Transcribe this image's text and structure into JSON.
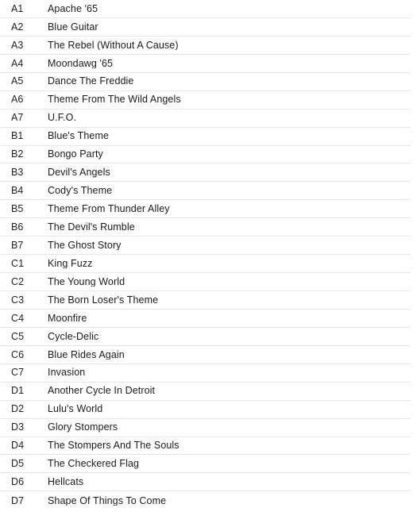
{
  "table": {
    "name": "tracklist",
    "columns": [
      "position",
      "title"
    ],
    "row_count": 28,
    "divider_color": "#e6e6e6",
    "text_color": "#1a1a1a",
    "background_color": "#ffffff"
  },
  "tracks": [
    {
      "position": "A1",
      "title": "Apache '65",
      "duration": ""
    },
    {
      "position": "A2",
      "title": "Blue Guitar",
      "duration": ""
    },
    {
      "position": "A3",
      "title": "The Rebel (Without A Cause)",
      "duration": ""
    },
    {
      "position": "A4",
      "title": "Moondawg '65",
      "duration": ""
    },
    {
      "position": "A5",
      "title": "Dance The Freddie",
      "duration": ""
    },
    {
      "position": "A6",
      "title": "Theme From The Wild Angels",
      "duration": ""
    },
    {
      "position": "A7",
      "title": "U.F.O.",
      "duration": ""
    },
    {
      "position": "B1",
      "title": "Blue's Theme",
      "duration": ""
    },
    {
      "position": "B2",
      "title": "Bongo Party",
      "duration": ""
    },
    {
      "position": "B3",
      "title": "Devil's Angels",
      "duration": ""
    },
    {
      "position": "B4",
      "title": "Cody's Theme",
      "duration": ""
    },
    {
      "position": "B5",
      "title": "Theme From Thunder Alley",
      "duration": ""
    },
    {
      "position": "B6",
      "title": "The Devil's Rumble",
      "duration": ""
    },
    {
      "position": "B7",
      "title": "The Ghost Story",
      "duration": ""
    },
    {
      "position": "C1",
      "title": "King Fuzz",
      "duration": ""
    },
    {
      "position": "C2",
      "title": "The Young World",
      "duration": ""
    },
    {
      "position": "C3",
      "title": "The Born Loser's Theme",
      "duration": ""
    },
    {
      "position": "C4",
      "title": "Moonfire",
      "duration": ""
    },
    {
      "position": "C5",
      "title": "Cycle-Delic",
      "duration": ""
    },
    {
      "position": "C6",
      "title": "Blue Rides Again",
      "duration": ""
    },
    {
      "position": "C7",
      "title": "Invasion",
      "duration": ""
    },
    {
      "position": "D1",
      "title": "Another Cycle In Detroit",
      "duration": ""
    },
    {
      "position": "D2",
      "title": "Lulu's World",
      "duration": ""
    },
    {
      "position": "D3",
      "title": "Glory Stompers",
      "duration": ""
    },
    {
      "position": "D4",
      "title": "The Stompers And The Souls",
      "duration": ""
    },
    {
      "position": "D5",
      "title": "The Checkered Flag",
      "duration": ""
    },
    {
      "position": "D6",
      "title": "Hellcats",
      "duration": ""
    },
    {
      "position": "D7",
      "title": "Shape Of Things To Come",
      "duration": ""
    }
  ]
}
